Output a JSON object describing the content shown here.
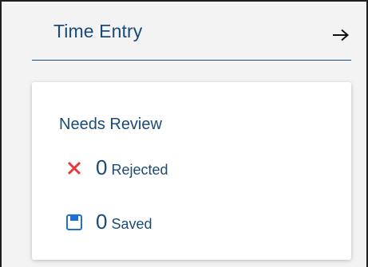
{
  "header": {
    "title": "Time Entry",
    "arrow_icon": "arrow-right-icon"
  },
  "card": {
    "title": "Needs Review",
    "items": [
      {
        "count": "0",
        "label": "Rejected",
        "icon": "close-icon",
        "icon_color": "#e53935"
      },
      {
        "count": "0",
        "label": "Saved",
        "icon": "save-icon",
        "icon_color": "#1e6fd9"
      }
    ]
  },
  "colors": {
    "primary_text": "#1b4a79",
    "divider": "#1e4b7a"
  }
}
